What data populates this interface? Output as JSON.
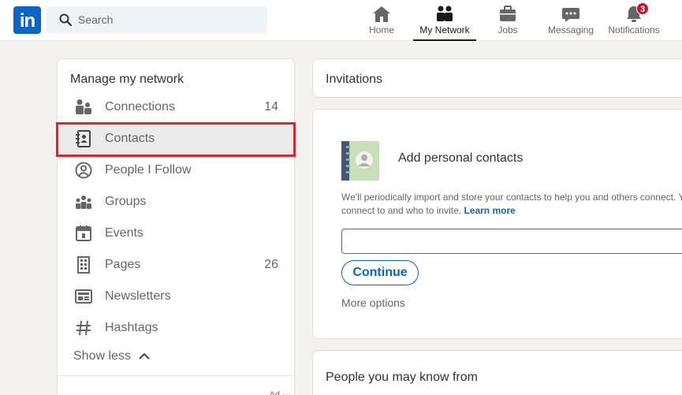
{
  "navbar": {
    "logo_text": "in",
    "search_placeholder": "Search",
    "items": [
      {
        "label": "Home",
        "icon": "home-icon"
      },
      {
        "label": "My Network",
        "icon": "my-network-icon",
        "active": true
      },
      {
        "label": "Jobs",
        "icon": "briefcase-icon"
      },
      {
        "label": "Messaging",
        "icon": "messaging-icon"
      },
      {
        "label": "Notifications",
        "icon": "bell-icon",
        "badge": "3"
      }
    ]
  },
  "sidebar": {
    "title": "Manage my network",
    "items": [
      {
        "label": "Connections",
        "count": "14",
        "icon": "connections-icon"
      },
      {
        "label": "Contacts",
        "count": "",
        "icon": "contacts-book-icon",
        "selected": true
      },
      {
        "label": "People I Follow",
        "count": "",
        "icon": "people-follow-icon"
      },
      {
        "label": "Groups",
        "count": "",
        "icon": "groups-icon"
      },
      {
        "label": "Events",
        "count": "",
        "icon": "calendar-icon"
      },
      {
        "label": "Pages",
        "count": "26",
        "icon": "building-icon"
      },
      {
        "label": "Newsletters",
        "count": "",
        "icon": "newsletter-icon"
      },
      {
        "label": "Hashtags",
        "count": "",
        "icon": "hashtag-icon"
      }
    ],
    "show_less": "Show less",
    "ad_label": "Ad"
  },
  "invitations": {
    "title": "Invitations"
  },
  "contacts_card": {
    "title": "Add personal contacts",
    "desc_line1": "We'll periodically import and store your contacts to help you and others connect. Y",
    "desc_line2": "connect to and who to invite.",
    "learn_more": "Learn more",
    "email_value": "",
    "continue_label": "Continue",
    "more_options": "More options"
  },
  "pymk": {
    "title": "People you may know from"
  },
  "colors": {
    "brand": "#0a66c2",
    "highlight": "#e0242f",
    "badge": "#cb112d"
  }
}
